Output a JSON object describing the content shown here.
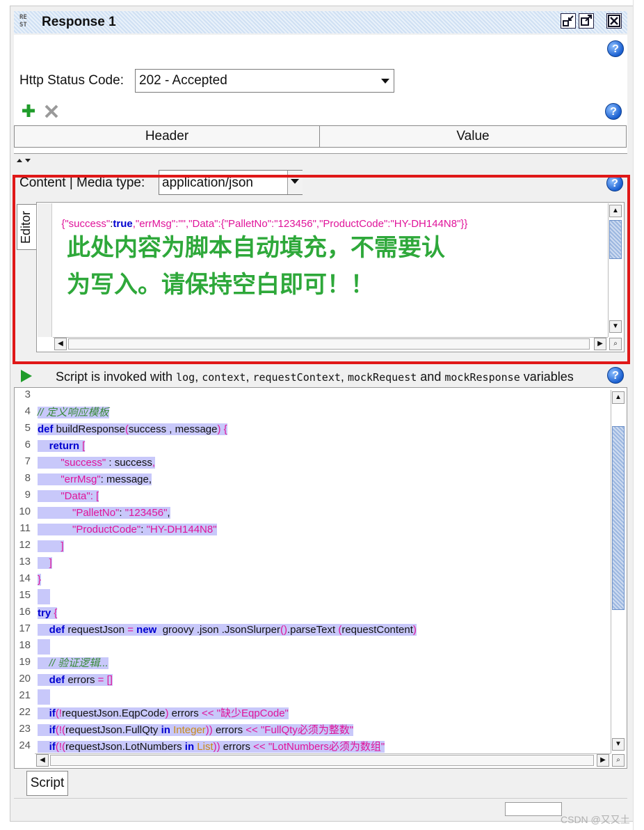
{
  "window": {
    "rest_icon": "RE ST",
    "title": "Response 1",
    "buttons": [
      "minimize-icon",
      "maximize-icon",
      "close-icon"
    ]
  },
  "status": {
    "label": "Http Status Code:",
    "value": "202 - Accepted"
  },
  "headers_table": {
    "columns": [
      "Header",
      "Value"
    ]
  },
  "content": {
    "label": "Content | Media type:",
    "media_type": "application/json",
    "editor_tab": "Editor",
    "json_parts": {
      "p1": "{\"success\"",
      "p2": ":",
      "p3": "true",
      "p4": ",\"errMsg\":\"\",\"Data\":{\"PalletNo\":\"123456\",\"ProductCode\":\"HY-DH144N8\"}}"
    },
    "overlay_line1": "此处内容为脚本自动填充，不需要认",
    "overlay_line2": "为写入。请保持空白即可！！"
  },
  "script": {
    "intro_pre": "Script is invoked with",
    "var1": "log",
    "sep1": ",",
    "var2": "context",
    "sep2": ",",
    "var3": "requestContext",
    "sep3": ",",
    "var4": "mockRequest",
    "and": "and",
    "var5": "mockResponse",
    "variables": "variables",
    "line_numbers": [
      "3",
      "4",
      "5",
      "6",
      "7",
      "8",
      "9",
      "10",
      "11",
      "12",
      "13",
      "14",
      "15",
      "16",
      "17",
      "18",
      "19",
      "20",
      "21",
      "22",
      "23",
      "24"
    ],
    "lines": [
      [],
      [
        {
          "t": "// 定义响应模板",
          "c": "cm"
        }
      ],
      [
        {
          "t": "def",
          "c": "kw"
        },
        {
          "t": " buildResponse",
          "c": "pl"
        },
        {
          "t": "(",
          "c": "str"
        },
        {
          "t": "success",
          "c": "pl"
        },
        {
          "t": " , ",
          "c": "pl"
        },
        {
          "t": "message",
          "c": "pl"
        },
        {
          "t": ")",
          "c": "str"
        },
        {
          "t": " {",
          "c": "str"
        }
      ],
      [
        {
          "t": "    return",
          "c": "kw"
        },
        {
          "t": " [",
          "c": "str"
        }
      ],
      [
        {
          "t": "        \"success\"",
          "c": "str"
        },
        {
          "t": " : success",
          "c": "pl"
        },
        {
          "t": ",",
          "c": "str"
        }
      ],
      [
        {
          "t": "        \"errMsg\"",
          "c": "str"
        },
        {
          "t": ": message,",
          "c": "pl"
        }
      ],
      [
        {
          "t": "        \"Data\"",
          "c": "str"
        },
        {
          "t": ": [",
          "c": "str"
        }
      ],
      [
        {
          "t": "            \"PalletNo\"",
          "c": "str"
        },
        {
          "t": ": ",
          "c": "pl"
        },
        {
          "t": "\"123456\"",
          "c": "str"
        },
        {
          "t": ",",
          "c": "pl"
        }
      ],
      [
        {
          "t": "            \"ProductCode\"",
          "c": "str"
        },
        {
          "t": ": ",
          "c": "pl"
        },
        {
          "t": "\"HY-DH144N8\"",
          "c": "str"
        }
      ],
      [
        {
          "t": "        ]",
          "c": "str"
        }
      ],
      [
        {
          "t": "    ]",
          "c": "str"
        }
      ],
      [
        {
          "t": "}",
          "c": "str"
        }
      ],
      [],
      [
        {
          "t": "try",
          "c": "kw"
        },
        {
          "t": " {",
          "c": "str"
        }
      ],
      [
        {
          "t": "    def",
          "c": "kw"
        },
        {
          "t": " requestJson",
          "c": "pl"
        },
        {
          "t": " = ",
          "c": "str"
        },
        {
          "t": "new",
          "c": "kw"
        },
        {
          "t": "  groovy .json .JsonSlurper",
          "c": "pl"
        },
        {
          "t": "()",
          "c": "str"
        },
        {
          "t": ".parseText ",
          "c": "pl"
        },
        {
          "t": "(",
          "c": "str"
        },
        {
          "t": "requestContent",
          "c": "pl"
        },
        {
          "t": ")",
          "c": "str"
        }
      ],
      [],
      [
        {
          "t": "    // 验证逻辑...",
          "c": "cm"
        }
      ],
      [
        {
          "t": "    def",
          "c": "kw"
        },
        {
          "t": " errors",
          "c": "pl"
        },
        {
          "t": " = []",
          "c": "str"
        }
      ],
      [],
      [
        {
          "t": "    if",
          "c": "kw"
        },
        {
          "t": "(!",
          "c": "str"
        },
        {
          "t": "requestJson.EqpCode",
          "c": "pl"
        },
        {
          "t": ")",
          "c": "str"
        },
        {
          "t": " errors ",
          "c": "pl"
        },
        {
          "t": "<< ",
          "c": "str"
        },
        {
          "t": "\"缺少EqpCode\"",
          "c": "str"
        }
      ],
      [
        {
          "t": "    if",
          "c": "kw"
        },
        {
          "t": "(!(",
          "c": "str"
        },
        {
          "t": "requestJson.FullQty",
          "c": "pl"
        },
        {
          "t": " in ",
          "c": "kw"
        },
        {
          "t": "Integer",
          "c": "ty"
        },
        {
          "t": "))",
          "c": "str"
        },
        {
          "t": " errors ",
          "c": "pl"
        },
        {
          "t": "<< ",
          "c": "str"
        },
        {
          "t": "\"FullQty必须为整数\"",
          "c": "str"
        }
      ],
      [
        {
          "t": "    if",
          "c": "kw"
        },
        {
          "t": "(!(",
          "c": "str"
        },
        {
          "t": "requestJson.LotNumbers",
          "c": "pl"
        },
        {
          "t": " in ",
          "c": "kw"
        },
        {
          "t": "List",
          "c": "ty"
        },
        {
          "t": "))",
          "c": "str"
        },
        {
          "t": " errors ",
          "c": "pl"
        },
        {
          "t": "<< ",
          "c": "str"
        },
        {
          "t": "\"LotNumbers必须为数组\"",
          "c": "str"
        }
      ]
    ],
    "bottom_tab": "Script"
  },
  "watermark": "CSDN @又又土",
  "colors": {
    "highlight_border": "#e01818",
    "selection": "#c8c8fa",
    "overlay_text": "#2ea83a",
    "keyword": "#0000d0",
    "string": "#e0149a"
  }
}
